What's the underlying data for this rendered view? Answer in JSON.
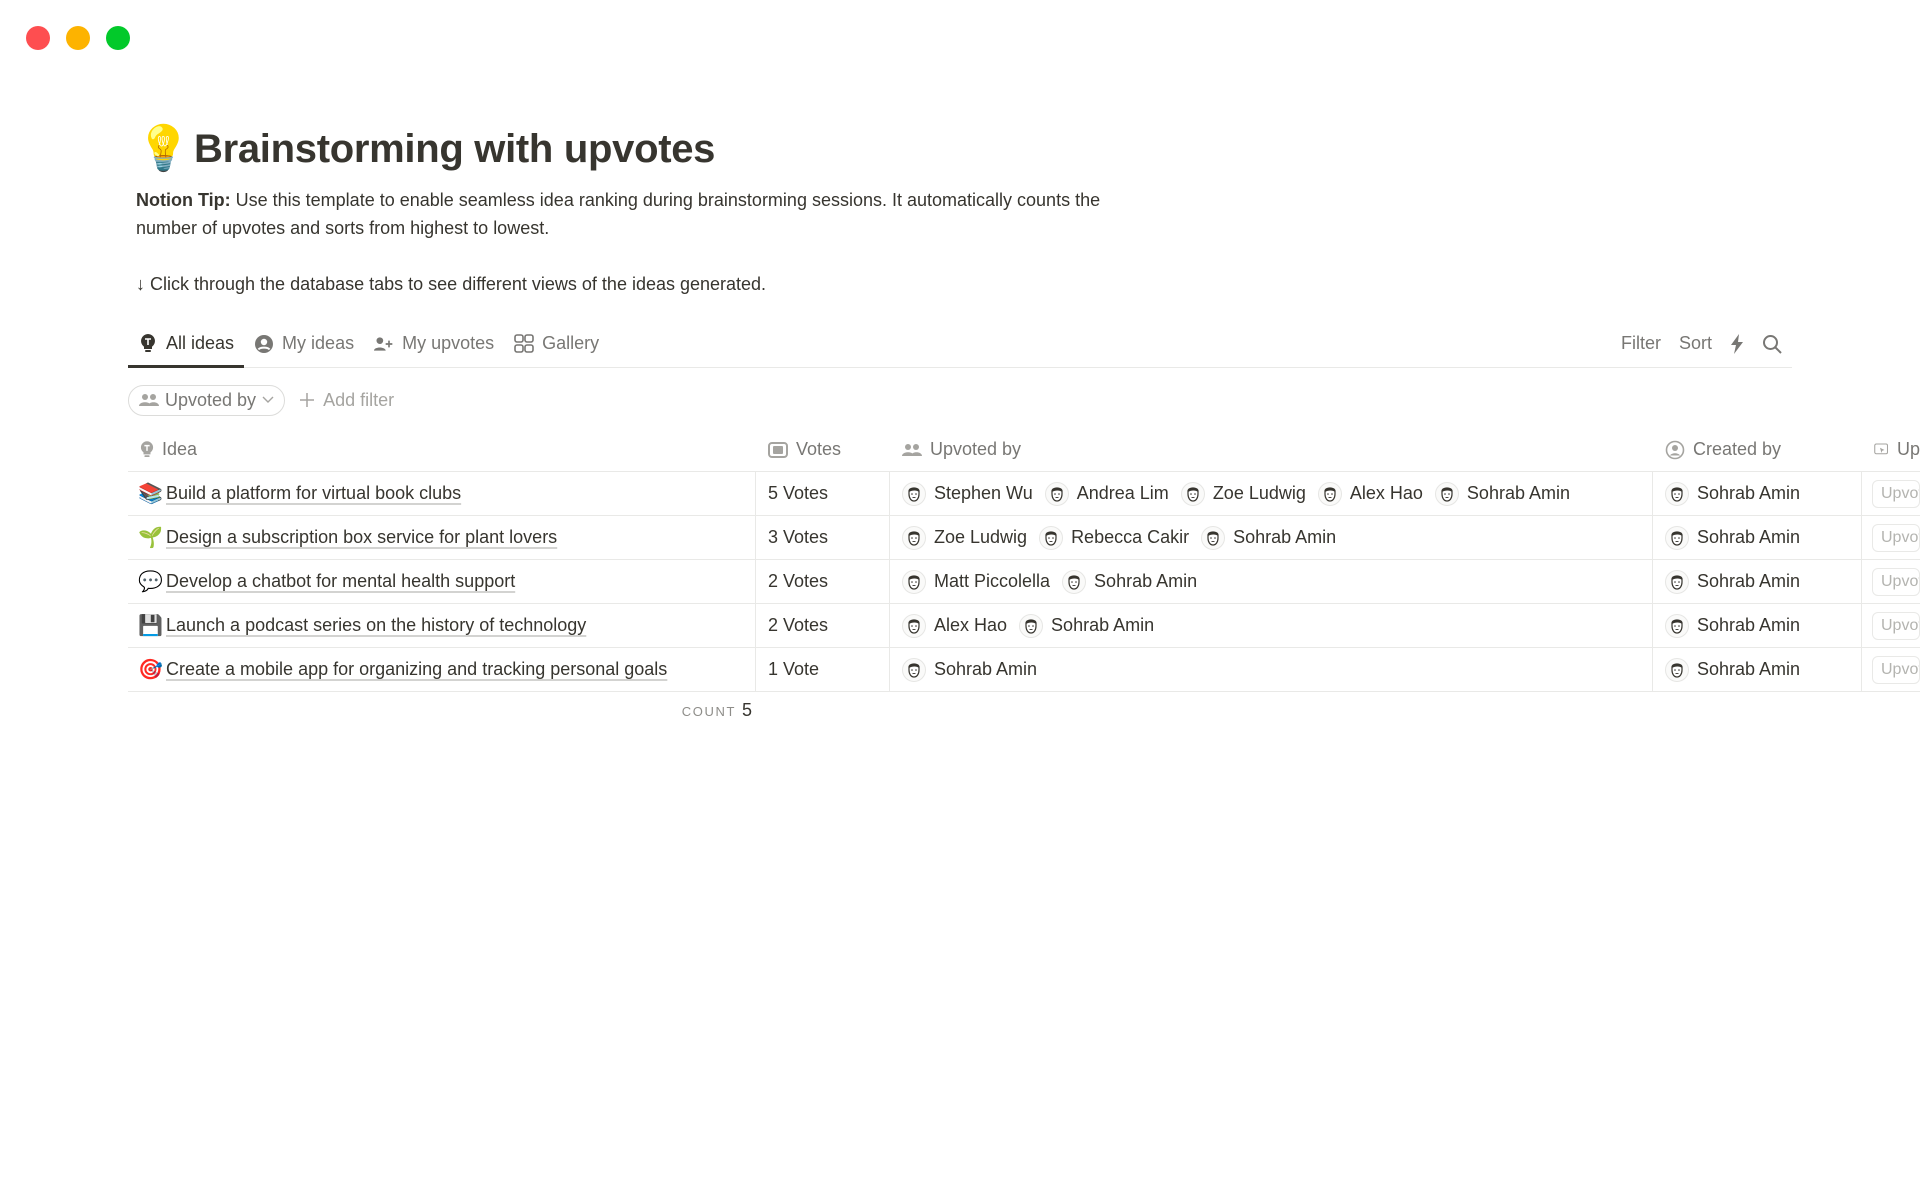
{
  "window": {
    "controls": [
      "close",
      "minimize",
      "maximize"
    ]
  },
  "page": {
    "icon": "💡",
    "title": "Brainstorming with upvotes",
    "tip_label": "Notion Tip:",
    "tip_text": " Use this template to enable seamless idea ranking during brainstorming sessions. It automatically counts the number of upvotes and sorts from highest to lowest.",
    "hint": "↓ Click through the database tabs to see different views of the ideas generated."
  },
  "tabs": [
    {
      "label": "All ideas",
      "icon": "lightbulb-icon",
      "active": true
    },
    {
      "label": "My ideas",
      "icon": "user-circle-icon",
      "active": false
    },
    {
      "label": "My upvotes",
      "icon": "user-plus-icon",
      "active": false
    },
    {
      "label": "Gallery",
      "icon": "gallery-grid-icon",
      "active": false
    }
  ],
  "toolbar": {
    "filter_label": "Filter",
    "sort_label": "Sort",
    "automation_icon": "lightning-icon",
    "search_icon": "search-icon"
  },
  "filters": {
    "active_chip": "Upvoted by",
    "add_filter_label": "Add filter"
  },
  "table": {
    "columns": [
      {
        "label": "Idea",
        "icon": "lightbulb-icon"
      },
      {
        "label": "Votes",
        "icon": "formula-icon"
      },
      {
        "label": "Upvoted by",
        "icon": "people-icon"
      },
      {
        "label": "Created by",
        "icon": "user-circle-icon"
      },
      {
        "label": "Up",
        "icon": "button-cursor-icon"
      }
    ],
    "rows": [
      {
        "emoji": "📚",
        "idea": "Build a platform for virtual book clubs",
        "votes": "5 Votes",
        "upvoted_by": [
          "Stephen Wu",
          "Andrea Lim",
          "Zoe Ludwig",
          "Alex Hao",
          "Sohrab Amin"
        ],
        "created_by": "Sohrab Amin",
        "button": "Upvote"
      },
      {
        "emoji": "🌱",
        "idea": "Design a subscription box service for plant lovers",
        "votes": "3 Votes",
        "upvoted_by": [
          "Zoe Ludwig",
          "Rebecca Cakir",
          "Sohrab Amin"
        ],
        "created_by": "Sohrab Amin",
        "button": "Upvote"
      },
      {
        "emoji": "💬",
        "idea": "Develop a chatbot for mental health support",
        "votes": "2 Votes",
        "upvoted_by": [
          "Matt Piccolella",
          "Sohrab Amin"
        ],
        "created_by": "Sohrab Amin",
        "button": "Upvote"
      },
      {
        "emoji": "💾",
        "idea": "Launch a podcast series on the history of technology",
        "votes": "2 Votes",
        "upvoted_by": [
          "Alex Hao",
          "Sohrab Amin"
        ],
        "created_by": "Sohrab Amin",
        "button": "Upvote"
      },
      {
        "emoji": "🎯",
        "idea": "Create a mobile app for organizing and tracking personal goals",
        "votes": "1 Vote",
        "upvoted_by": [
          "Sohrab Amin"
        ],
        "created_by": "Sohrab Amin",
        "button": "Upvote"
      }
    ],
    "footer": {
      "count_label": "COUNT",
      "count_value": "5"
    }
  }
}
